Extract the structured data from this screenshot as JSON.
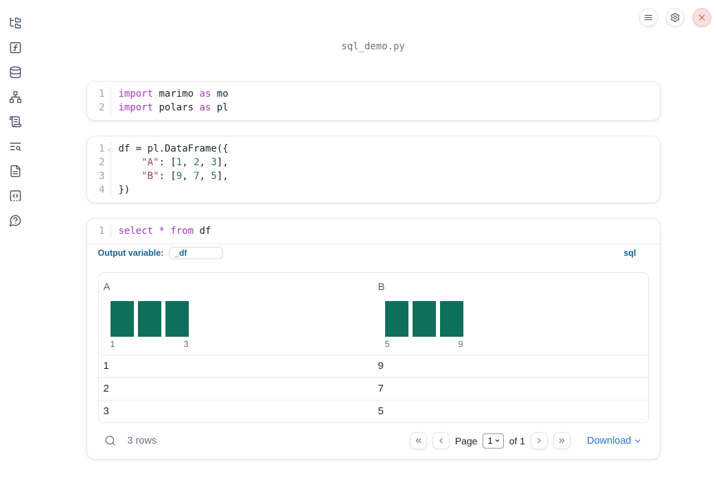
{
  "window": {
    "title": "sql_demo.py"
  },
  "topbar": {
    "buttons": [
      {
        "name": "menu",
        "icon": "hamburger-menu-icon"
      },
      {
        "name": "settings",
        "icon": "gear-icon"
      },
      {
        "name": "close",
        "icon": "close-icon"
      }
    ]
  },
  "sidebar": {
    "items": [
      {
        "name": "explorer",
        "icon": "folder-tree-icon"
      },
      {
        "name": "functions",
        "icon": "function-square-icon"
      },
      {
        "name": "data-sources",
        "icon": "database-icon"
      },
      {
        "name": "dependencies",
        "icon": "network-icon"
      },
      {
        "name": "scratchpad",
        "icon": "scroll-icon"
      },
      {
        "name": "logs",
        "icon": "text-search-icon"
      },
      {
        "name": "documentation",
        "icon": "file-text-icon"
      },
      {
        "name": "snippets",
        "icon": "code-square-icon"
      },
      {
        "name": "help",
        "icon": "help-circle-icon"
      }
    ]
  },
  "cells": [
    {
      "type": "python",
      "lines": [
        {
          "num": "1",
          "tokens": [
            {
              "c": "kw",
              "t": "import"
            },
            {
              "c": "pl",
              "t": " marimo "
            },
            {
              "c": "kw",
              "t": "as"
            },
            {
              "c": "pl",
              "t": " mo"
            }
          ]
        },
        {
          "num": "2",
          "tokens": [
            {
              "c": "kw",
              "t": "import"
            },
            {
              "c": "pl",
              "t": " polars "
            },
            {
              "c": "kw",
              "t": "as"
            },
            {
              "c": "pl",
              "t": " pl"
            }
          ]
        }
      ]
    },
    {
      "type": "python",
      "lines": [
        {
          "num": "1",
          "fold": true,
          "tokens": [
            {
              "c": "pl",
              "t": "df = pl.DataFrame({"
            }
          ]
        },
        {
          "num": "2",
          "tokens": [
            {
              "c": "pl",
              "t": "    "
            },
            {
              "c": "str",
              "t": "\"A\""
            },
            {
              "c": "pl",
              "t": ": ["
            },
            {
              "c": "num",
              "t": "1"
            },
            {
              "c": "pl",
              "t": ", "
            },
            {
              "c": "num",
              "t": "2"
            },
            {
              "c": "pl",
              "t": ", "
            },
            {
              "c": "num",
              "t": "3"
            },
            {
              "c": "pl",
              "t": "],"
            }
          ]
        },
        {
          "num": "3",
          "tokens": [
            {
              "c": "pl",
              "t": "    "
            },
            {
              "c": "str",
              "t": "\"B\""
            },
            {
              "c": "pl",
              "t": ": ["
            },
            {
              "c": "num",
              "t": "9"
            },
            {
              "c": "pl",
              "t": ", "
            },
            {
              "c": "num",
              "t": "7"
            },
            {
              "c": "pl",
              "t": ", "
            },
            {
              "c": "num",
              "t": "5"
            },
            {
              "c": "pl",
              "t": "],"
            }
          ]
        },
        {
          "num": "4",
          "tokens": [
            {
              "c": "pl",
              "t": "})"
            }
          ]
        }
      ]
    },
    {
      "type": "sql",
      "lines": [
        {
          "num": "1",
          "tokens": [
            {
              "c": "kw",
              "t": "select"
            },
            {
              "c": "pl",
              "t": " "
            },
            {
              "c": "kw",
              "t": "*"
            },
            {
              "c": "pl",
              "t": " "
            },
            {
              "c": "kw",
              "t": "from"
            },
            {
              "c": "pl",
              "t": " df"
            }
          ]
        }
      ]
    }
  ],
  "sql_cell": {
    "output_variable_label": "Output variable:",
    "output_variable_value": "_df",
    "language_badge": "sql"
  },
  "table": {
    "columns": [
      {
        "name": "A",
        "hist": {
          "counts": [
            1,
            1,
            1
          ],
          "min_label": "1",
          "max_label": "3"
        }
      },
      {
        "name": "B",
        "hist": {
          "counts": [
            1,
            1,
            1
          ],
          "min_label": "5",
          "max_label": "9"
        }
      }
    ],
    "rows": [
      [
        "1",
        "9"
      ],
      [
        "2",
        "7"
      ],
      [
        "3",
        "5"
      ]
    ],
    "footer": {
      "row_count": "3 rows",
      "page_label": "Page",
      "page_value": "1",
      "of_label": "of 1",
      "download_label": "Download"
    }
  },
  "chart_data": [
    {
      "type": "bar",
      "title": "Column A histogram",
      "categories": [
        "1",
        "2",
        "3"
      ],
      "values": [
        1,
        1,
        1
      ],
      "x_tick_labels": [
        "1",
        "3"
      ],
      "bar_color": "#0e6f5c"
    },
    {
      "type": "bar",
      "title": "Column B histogram",
      "categories": [
        "5",
        "7",
        "9"
      ],
      "values": [
        1,
        1,
        1
      ],
      "x_tick_labels": [
        "5",
        "9"
      ],
      "bar_color": "#0e6f5c"
    }
  ],
  "colors": {
    "accent_blue": "#17648f",
    "link_blue": "#2b72d9",
    "hist_green": "#0e6f5c",
    "keyword_purple": "#a13db8",
    "string_red": "#a2444b",
    "number_green": "#1b7c45",
    "close_red": "#d75252"
  }
}
